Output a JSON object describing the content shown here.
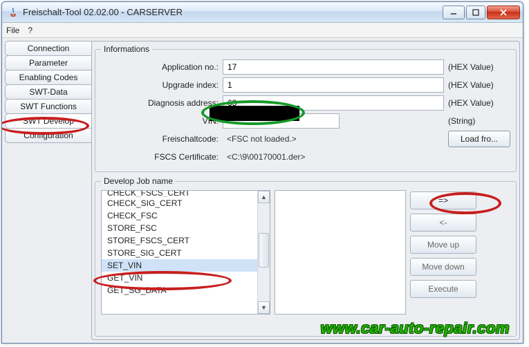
{
  "window": {
    "title": "Freischalt-Tool 02.02.00 - CARSERVER"
  },
  "menu": {
    "file": "File",
    "help": "?"
  },
  "tabs": [
    {
      "id": "connection",
      "label": "Connection"
    },
    {
      "id": "parameter",
      "label": "Parameter"
    },
    {
      "id": "enabling-codes",
      "label": "Enabling Codes"
    },
    {
      "id": "swt-data",
      "label": "SWT-Data"
    },
    {
      "id": "swt-functions",
      "label": "SWT Functions"
    },
    {
      "id": "swt-develop",
      "label": "SWT Develop",
      "active": true
    },
    {
      "id": "configuration",
      "label": "Configuration"
    }
  ],
  "informations": {
    "legend": "Informations",
    "rows": {
      "app_no": {
        "label": "Application no.:",
        "value": "17",
        "suffix": "(HEX Value)"
      },
      "upgrade": {
        "label": "Upgrade index:",
        "value": "1",
        "suffix": "(HEX Value)"
      },
      "diag": {
        "label": "Diagnosis address:",
        "value": "63",
        "suffix": "(HEX Value)"
      },
      "vin": {
        "label": "VIN:",
        "value": "",
        "suffix": "(String)"
      },
      "freischalt": {
        "label": "Freischaltcode:",
        "value": "<FSC not loaded.>",
        "button": "Load fro..."
      },
      "fscs": {
        "label": "FSCS Certificate:",
        "value": "<C:\\9\\00170001.der>"
      }
    }
  },
  "develop": {
    "legend": "Develop Job name",
    "items": [
      "CHECK_FSCS_CERT",
      "CHECK_SIG_CERT",
      "CHECK_FSC",
      "STORE_FSC",
      "STORE_FSCS_CERT",
      "STORE_SIG_CERT",
      "SET_VIN",
      "GET_VIN",
      "GET_SG_DATA"
    ],
    "selected_index": 6,
    "buttons": {
      "add": "=>",
      "remove": "<-",
      "moveup": "Move up",
      "movedown": "Move down",
      "execute": "Execute"
    }
  },
  "watermark": "www.car-auto-repair.com"
}
